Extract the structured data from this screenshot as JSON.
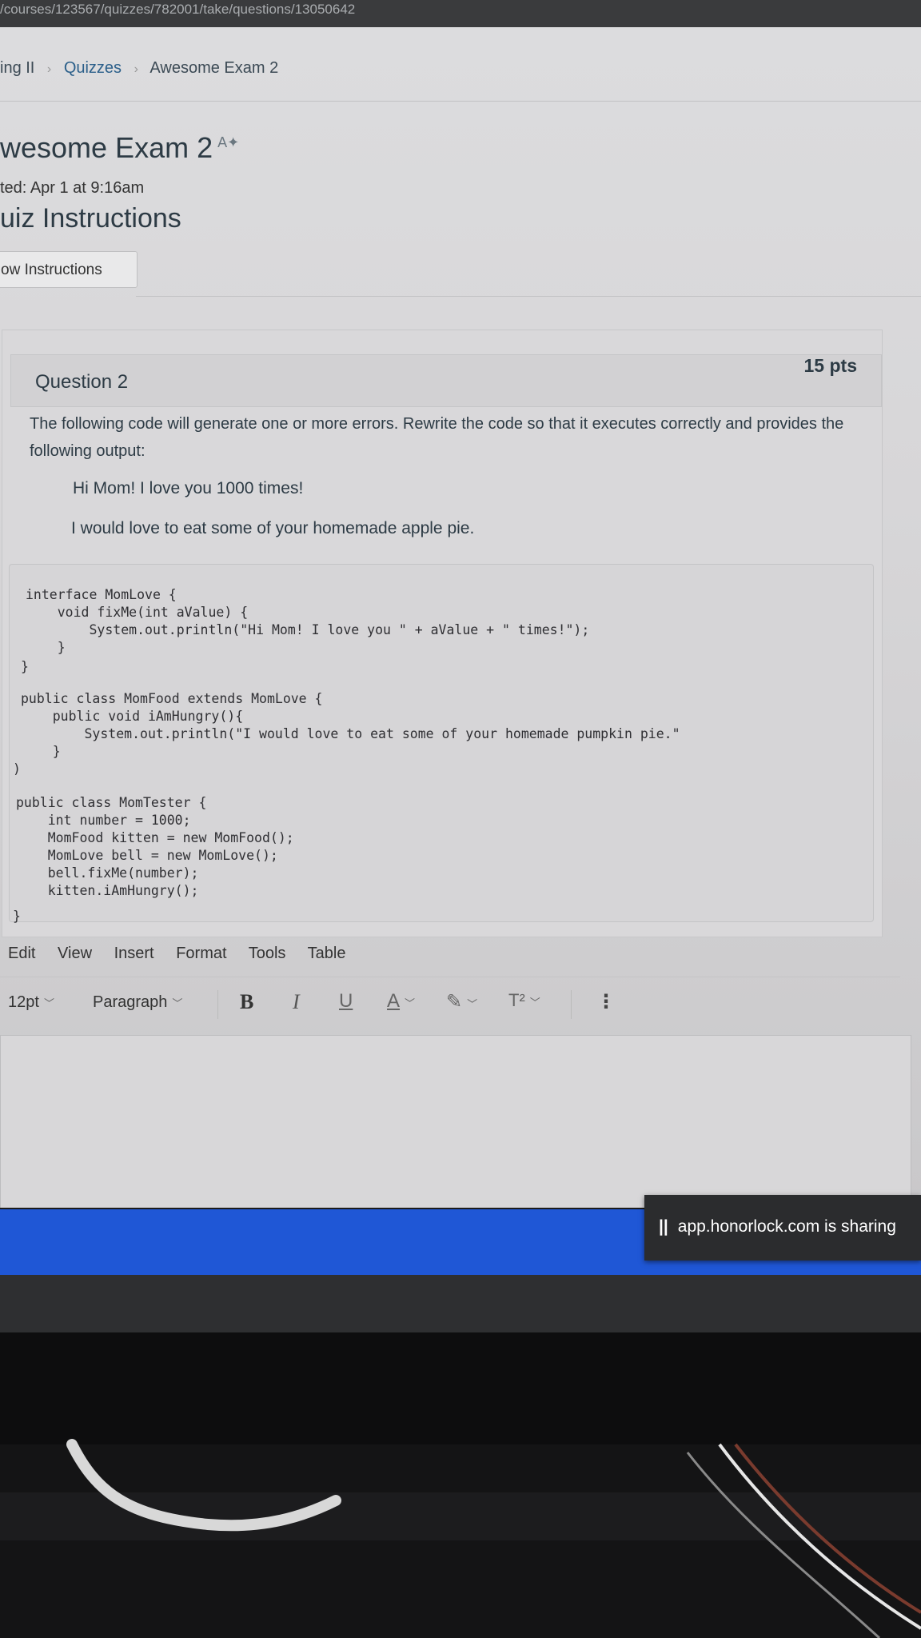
{
  "browser": {
    "url": "/courses/123567/quizzes/782001/take/questions/13050642"
  },
  "breadcrumb": {
    "item1": "ing II",
    "item2": "Quizzes",
    "item3": "Awesome Exam 2",
    "separator": "›"
  },
  "quiz": {
    "title": "wesome Exam 2",
    "started": "ted: Apr 1 at 9:16am",
    "instructions_heading": "uiz Instructions",
    "show_instructions_label": "ow Instructions"
  },
  "question": {
    "name": "Question 2",
    "points": "15 pts",
    "prompt": "The following code will generate one or more errors. Rewrite the code so that it executes correctly and provides the following output:",
    "output_line1": "Hi Mom! I love you 1000 times!",
    "output_line2": "I would love to eat some of your homemade apple pie.",
    "code": [
      "interface MomLove {",
      "    void fixMe(int aValue) {",
      "        System.out.println(\"Hi Mom! I love you \" + aValue + \" times!\");",
      "    }",
      "}",
      "public class MomFood extends MomLove {",
      "    public void iAmHungry(){",
      "        System.out.println(\"I would love to eat some of your homemade pumpkin pie.\"",
      "    }",
      ")",
      "public class MomTester {",
      "    int number = 1000;",
      "    MomFood kitten = new MomFood();",
      "    MomLove bell = new MomLove();",
      "    bell.fixMe(number);",
      "    kitten.iAmHungry();",
      "}"
    ]
  },
  "editor": {
    "menu": [
      "Edit",
      "View",
      "Insert",
      "Format",
      "Tools",
      "Table"
    ],
    "font_size": "12pt",
    "block_format": "Paragraph",
    "bold": "B",
    "italic": "I",
    "underline": "U",
    "text_color": "A",
    "superscript": "T²",
    "more": "⋮",
    "content": ""
  },
  "sharing_bar": {
    "text": "app.honorlock.com is sharing",
    "icon": "pause-icon"
  },
  "colors": {
    "share_band": "#1f57d6",
    "link": "#2b5f8a",
    "page_bg": "#d8d7d9"
  }
}
